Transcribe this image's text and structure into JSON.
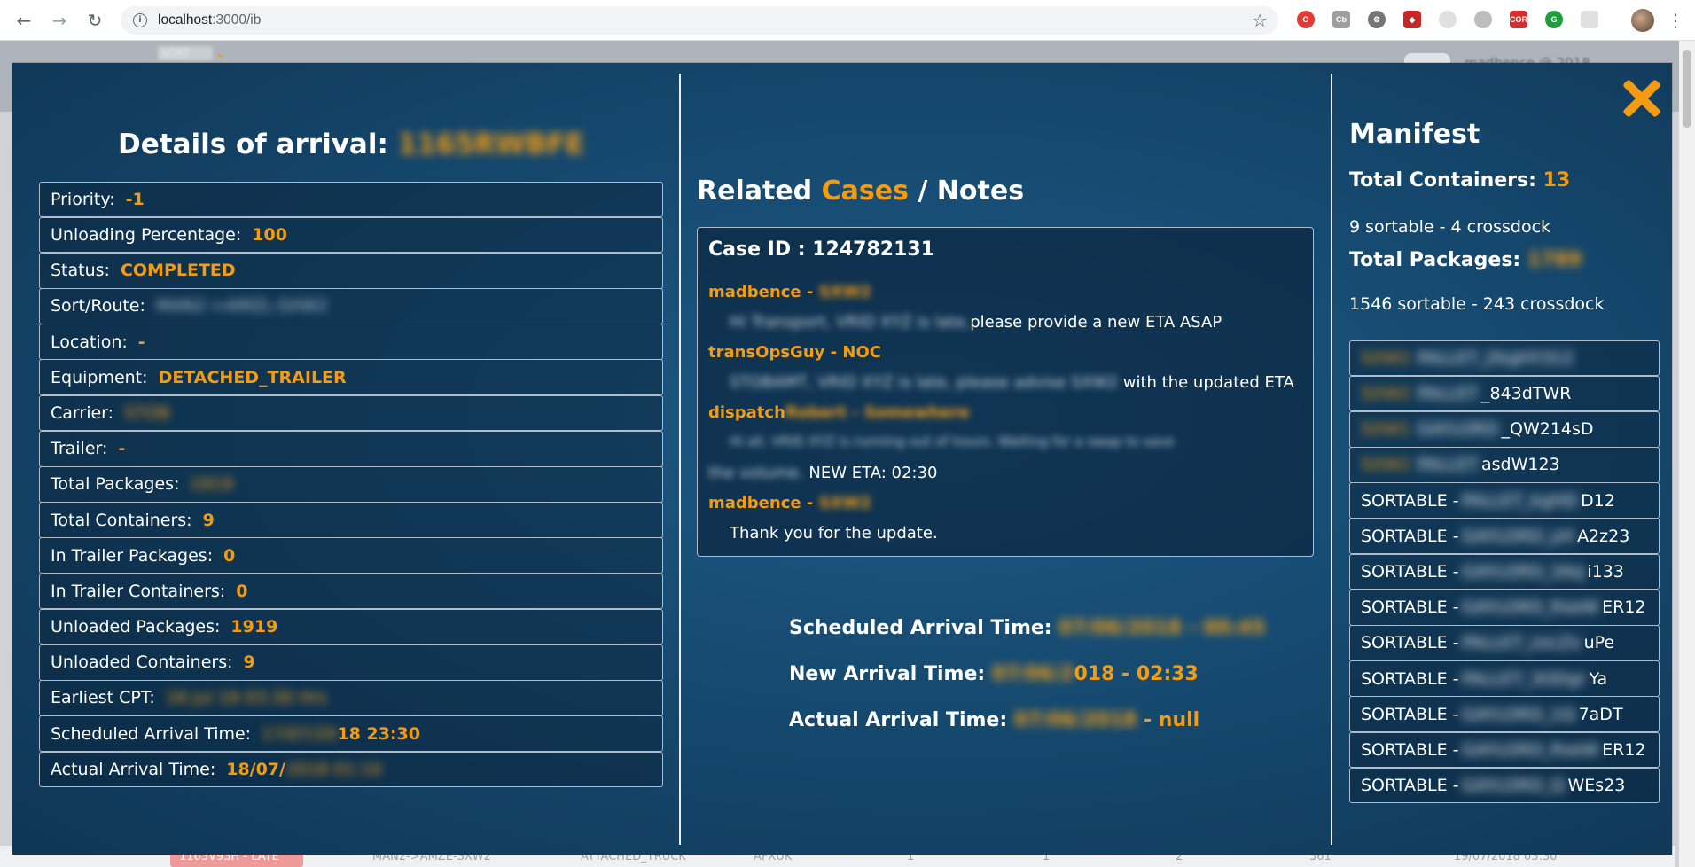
{
  "browser": {
    "url_host": "localhost",
    "url_path": ":3000/ib",
    "back_icon": "arrow-left-icon",
    "forward_icon": "arrow-right-icon",
    "reload_icon": "reload-icon",
    "bookmark_icon": "star-icon",
    "menu_icon": "kebab-menu-icon"
  },
  "background_page": {
    "menu_label": "SORT",
    "user_text": "madbence @ 2018",
    "row": {
      "badge": "1163V93H - LATE",
      "route": "MAN2->AMZE-SXW2",
      "equipment": "ATTACHED_TRUCK",
      "carrier": "AFXUK",
      "c1": "1",
      "c2": "1",
      "c3": "2",
      "c4": "361",
      "time": "19/07/2018 03:30"
    }
  },
  "modal": {
    "accent_color": "#f39c12",
    "close_icon": "close-icon",
    "details": {
      "title_prefix": "Details of arrival:",
      "title_id": "1165RWBFE",
      "rows": [
        {
          "label": "Priority:",
          "value": "-1",
          "blurred": false
        },
        {
          "label": "Unloading Percentage:",
          "value": "100",
          "blurred": false
        },
        {
          "label": "Status:",
          "value": "COMPLETED",
          "blurred": false
        },
        {
          "label": "Sort/Route:",
          "value": "MAN2->AMZL-SXW2",
          "blurred": true
        },
        {
          "label": "Location:",
          "value": "-",
          "blurred": false
        },
        {
          "label": "Equipment:",
          "value": "DETACHED_TRAILER",
          "blurred": false
        },
        {
          "label": "Carrier:",
          "value": "STOB",
          "blurred": true
        },
        {
          "label": "Trailer:",
          "value": "-",
          "blurred": false
        },
        {
          "label": "Total Packages:",
          "value": "1919",
          "blurred": true
        },
        {
          "label": "Total Containers:",
          "value": "9",
          "blurred": false
        },
        {
          "label": "In Trailer Packages:",
          "value": "0",
          "blurred": false
        },
        {
          "label": "In Trailer Containers:",
          "value": "0",
          "blurred": false
        },
        {
          "label": "Unloaded Packages:",
          "value": "1919",
          "blurred": false
        },
        {
          "label": "Unloaded Containers:",
          "value": "9",
          "blurred": false
        },
        {
          "label": "Earliest CPT:",
          "value": "18 Jul 18 03:30 Hrs",
          "blurred": true
        }
      ],
      "scheduled": {
        "label": "Scheduled Arrival Time:",
        "value_hidden": "17/07/20",
        "value_visible": "18 23:30"
      },
      "actual": {
        "label": "Actual Arrival Time:",
        "value_visible": "18/07/",
        "value_hidden": "2018 01:10"
      }
    },
    "notes": {
      "title_related": "Related",
      "title_cases": "Cases",
      "title_sep": "/",
      "title_notes": "Notes",
      "case_id": "Case ID : 124782131",
      "entries": [
        {
          "author": "madbence -",
          "author_hidden": "SXW2",
          "text_hidden": "Hi Transport, VRID XYZ is late,",
          "text": "please provide a new ETA ASAP"
        },
        {
          "author": "transOpsGuy - NOC",
          "author_hidden": "",
          "text_hidden": "STOBAMT, VRID XYZ is late, please advise SXW2",
          "text": "with the updated ETA"
        },
        {
          "author": "dispatch",
          "author_hidden": "Robert - Somewhere",
          "text_hidden": "Hi all, VRID XYZ is running out of hours. Waiting for a swap to save",
          "text_hidden2": "the volume.",
          "text": "NEW ETA: 02:30"
        },
        {
          "author": "madbence -",
          "author_hidden": "SXW2",
          "text_hidden": "",
          "text": "Thank you for the update."
        }
      ],
      "scheduled": {
        "label": "Scheduled Arrival Time:",
        "value_hidden": "07/06/2018 - 00:45"
      },
      "new": {
        "label": "New Arrival Time:",
        "value_hidden": "07/06/2",
        "value_visible": "018 - 02:33"
      },
      "actual": {
        "label": "Actual Arrival Time:",
        "value_hidden": "07/06/2018",
        "value_visible": "- null"
      }
    },
    "manifest": {
      "title": "Manifest",
      "total_containers_label": "Total Containers:",
      "total_containers_value": "13",
      "containers_split": "9 sortable - 4 crossdock",
      "total_packages_label": "Total Packages:",
      "total_packages_value": "1789",
      "packages_split": "1546 sortable - 243 crossdock",
      "containers": [
        {
          "type": "SXW2",
          "hidden": "PALLET_ZkgHY312",
          "visible": "",
          "blur_type": true
        },
        {
          "type": "SXW2",
          "hidden": "PALLET",
          "visible": "_843dTWR",
          "blur_type": true
        },
        {
          "type": "SXW1",
          "hidden": "GAYLORD",
          "visible": "_QW214sD",
          "blur_type": true
        },
        {
          "type": "SXW2",
          "hidden": "PALLET",
          "visible": "asdW123",
          "blur_type": true
        },
        {
          "type": "SORTABLE -",
          "hidden": "PALLET_kgHD",
          "visible": "D12",
          "blur_type": false
        },
        {
          "type": "SORTABLE -",
          "hidden": "GAYLORD_yH",
          "visible": "A2z23",
          "blur_type": false
        },
        {
          "type": "SORTABLE -",
          "hidden": "GAYLORD_3Aq",
          "visible": "i133",
          "blur_type": false
        },
        {
          "type": "SORTABLE -",
          "hidden": "GAYLORD_RseW",
          "visible": "ER12",
          "blur_type": false
        },
        {
          "type": "SORTABLE -",
          "hidden": "PALLET_zxcZx",
          "visible": "uPe",
          "blur_type": false
        },
        {
          "type": "SORTABLE -",
          "hidden": "PALLET_3ODgr",
          "visible": "Ya",
          "blur_type": false
        },
        {
          "type": "SORTABLE -",
          "hidden": "GAYLORD_1Q",
          "visible": "7aDT",
          "blur_type": false
        },
        {
          "type": "SORTABLE -",
          "hidden": "GAYLORD_RseW",
          "visible": "ER12",
          "blur_type": false
        },
        {
          "type": "SORTABLE -",
          "hidden": "GAYLORD_Q",
          "visible": "WEs23",
          "blur_type": false
        }
      ]
    }
  }
}
